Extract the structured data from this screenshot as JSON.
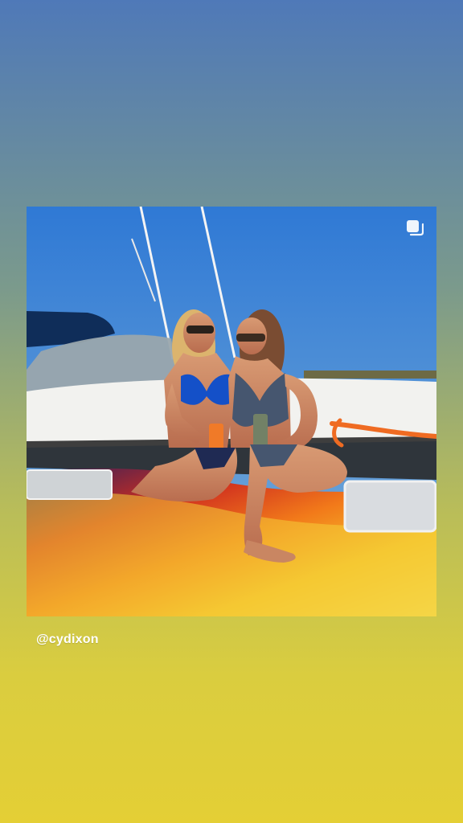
{
  "story": {
    "username": "@cydixon"
  },
  "icons": {
    "multi_post": "multiple-posts-icon"
  },
  "colors": {
    "background_top": "#4f79b8",
    "background_bottom": "#e4cf35",
    "sky": "#3b7fd4",
    "boat_white": "#f2f2ef",
    "hull_orange": "#f28b1b",
    "hull_yellow": "#f2d33b"
  }
}
